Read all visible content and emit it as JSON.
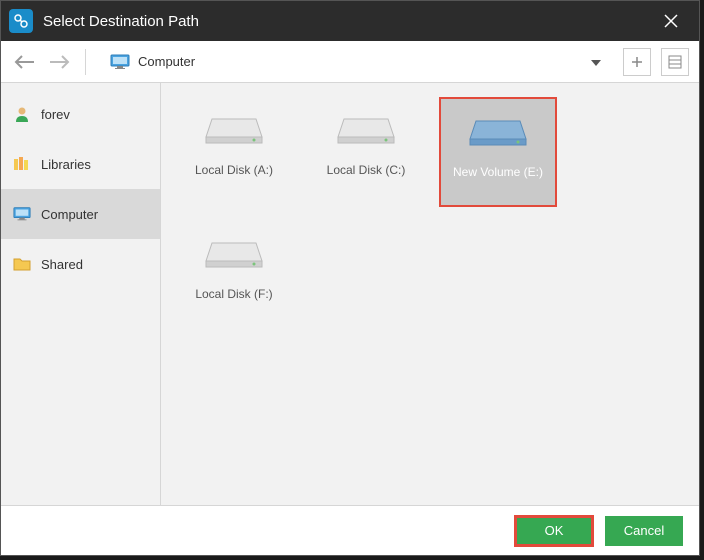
{
  "titlebar": {
    "title": "Select Destination Path"
  },
  "toolbar": {
    "path_label": "Computer"
  },
  "sidebar": {
    "items": [
      {
        "label": "forev"
      },
      {
        "label": "Libraries"
      },
      {
        "label": "Computer"
      },
      {
        "label": "Shared"
      }
    ]
  },
  "drives": [
    {
      "label": "Local Disk (A:)"
    },
    {
      "label": "Local Disk (C:)"
    },
    {
      "label": "New Volume (E:)"
    },
    {
      "label": "Local Disk (F:)"
    }
  ],
  "footer": {
    "ok_label": "OK",
    "cancel_label": "Cancel"
  }
}
